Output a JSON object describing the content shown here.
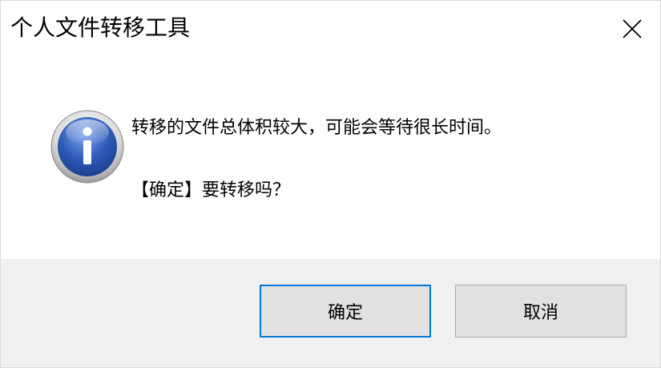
{
  "window": {
    "title": "个人文件转移工具"
  },
  "icons": {
    "close": "close-icon",
    "info": "info-icon"
  },
  "message": {
    "line1": "转移的文件总体积较大，可能会等待很长时间。",
    "line2": "【确定】要转移吗？"
  },
  "buttons": {
    "ok_label": "确定",
    "cancel_label": "取消"
  },
  "colors": {
    "footer_bg": "#f0f0f0",
    "button_bg": "#e1e1e1",
    "default_button_border": "#0078d7",
    "icon_blue": "#2e5bb8"
  }
}
